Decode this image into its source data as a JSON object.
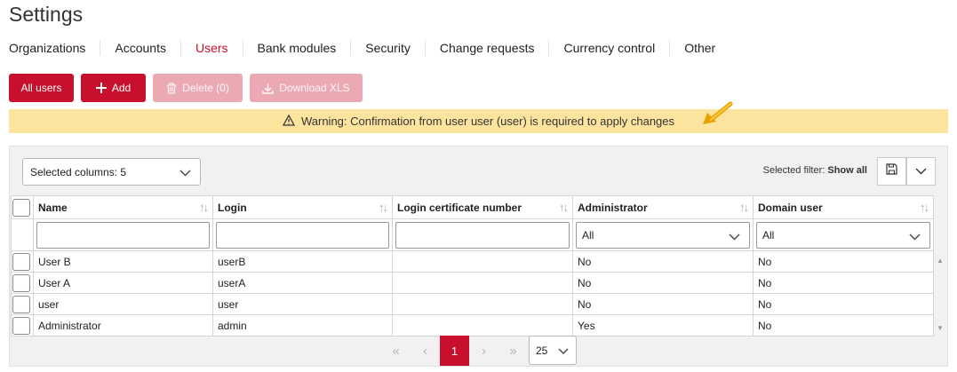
{
  "page": {
    "title": "Settings"
  },
  "tabs": [
    {
      "label": "Organizations"
    },
    {
      "label": "Accounts"
    },
    {
      "label": "Users",
      "active": true
    },
    {
      "label": "Bank modules"
    },
    {
      "label": "Security"
    },
    {
      "label": "Change requests"
    },
    {
      "label": "Currency control"
    },
    {
      "label": "Other"
    }
  ],
  "toolbar": {
    "all_users": "All users",
    "add": "Add",
    "delete": "Delete (0)",
    "download": "Download XLS"
  },
  "warning": {
    "text": "Warning: Confirmation from user user (user) is required to apply changes"
  },
  "grid": {
    "columns_selector": "Selected columns: 5",
    "filter_label": "Selected filter:",
    "filter_value": "Show all",
    "columns": [
      "Name",
      "Login",
      "Login certificate number",
      "Administrator",
      "Domain user"
    ],
    "filters": {
      "administrator": "All",
      "domain_user": "All"
    },
    "rows": [
      {
        "name": "User B",
        "login": "userB",
        "cert": "",
        "admin": "No",
        "domain": "No"
      },
      {
        "name": "User A",
        "login": "userA",
        "cert": "",
        "admin": "No",
        "domain": "No"
      },
      {
        "name": "user",
        "login": "user",
        "cert": "",
        "admin": "No",
        "domain": "No"
      },
      {
        "name": "Administrator",
        "login": "admin",
        "cert": "",
        "admin": "Yes",
        "domain": "No"
      }
    ]
  },
  "pagination": {
    "current_page": "1",
    "page_size": "25"
  },
  "colors": {
    "accent": "#c8102e",
    "accent_disabled": "#eba9b3",
    "warning_bg": "#fde49e",
    "arrow": "#f0b400"
  }
}
